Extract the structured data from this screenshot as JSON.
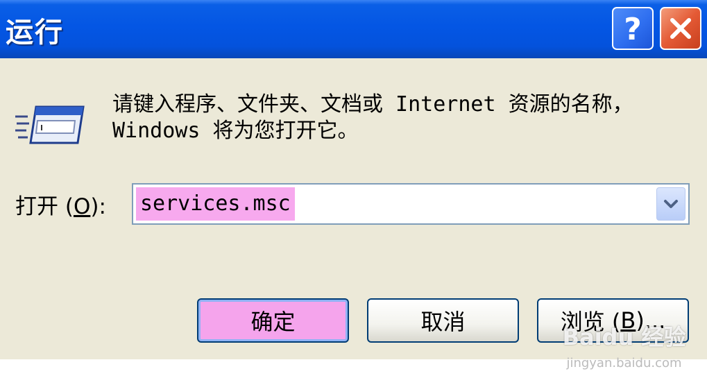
{
  "window": {
    "title": "运行"
  },
  "titlebar": {
    "help_glyph": "?",
    "close_glyph": "✕"
  },
  "prompt_text": "请键入程序、文件夹、文档或 Internet 资源的名称，Windows 将为您打开它。",
  "open_field": {
    "label_prefix": "打开 (",
    "label_accel": "O",
    "label_suffix": "):",
    "value": "services.msc"
  },
  "buttons": {
    "ok": "确定",
    "cancel": "取消",
    "browse_prefix": "浏览 (",
    "browse_accel": "B",
    "browse_suffix": ")..."
  },
  "watermark": {
    "main": "Baidu 经验",
    "sub": "jingyan.baidu.com"
  },
  "colors": {
    "titlebar": "#0456e4",
    "dialog_bg": "#ece9d8",
    "highlight": "#f5a4ec",
    "close_button": "#e45a35",
    "help_button": "#2f6ff0"
  },
  "icons": [
    "run-program-icon",
    "help-icon",
    "close-icon",
    "chevron-down-icon"
  ]
}
